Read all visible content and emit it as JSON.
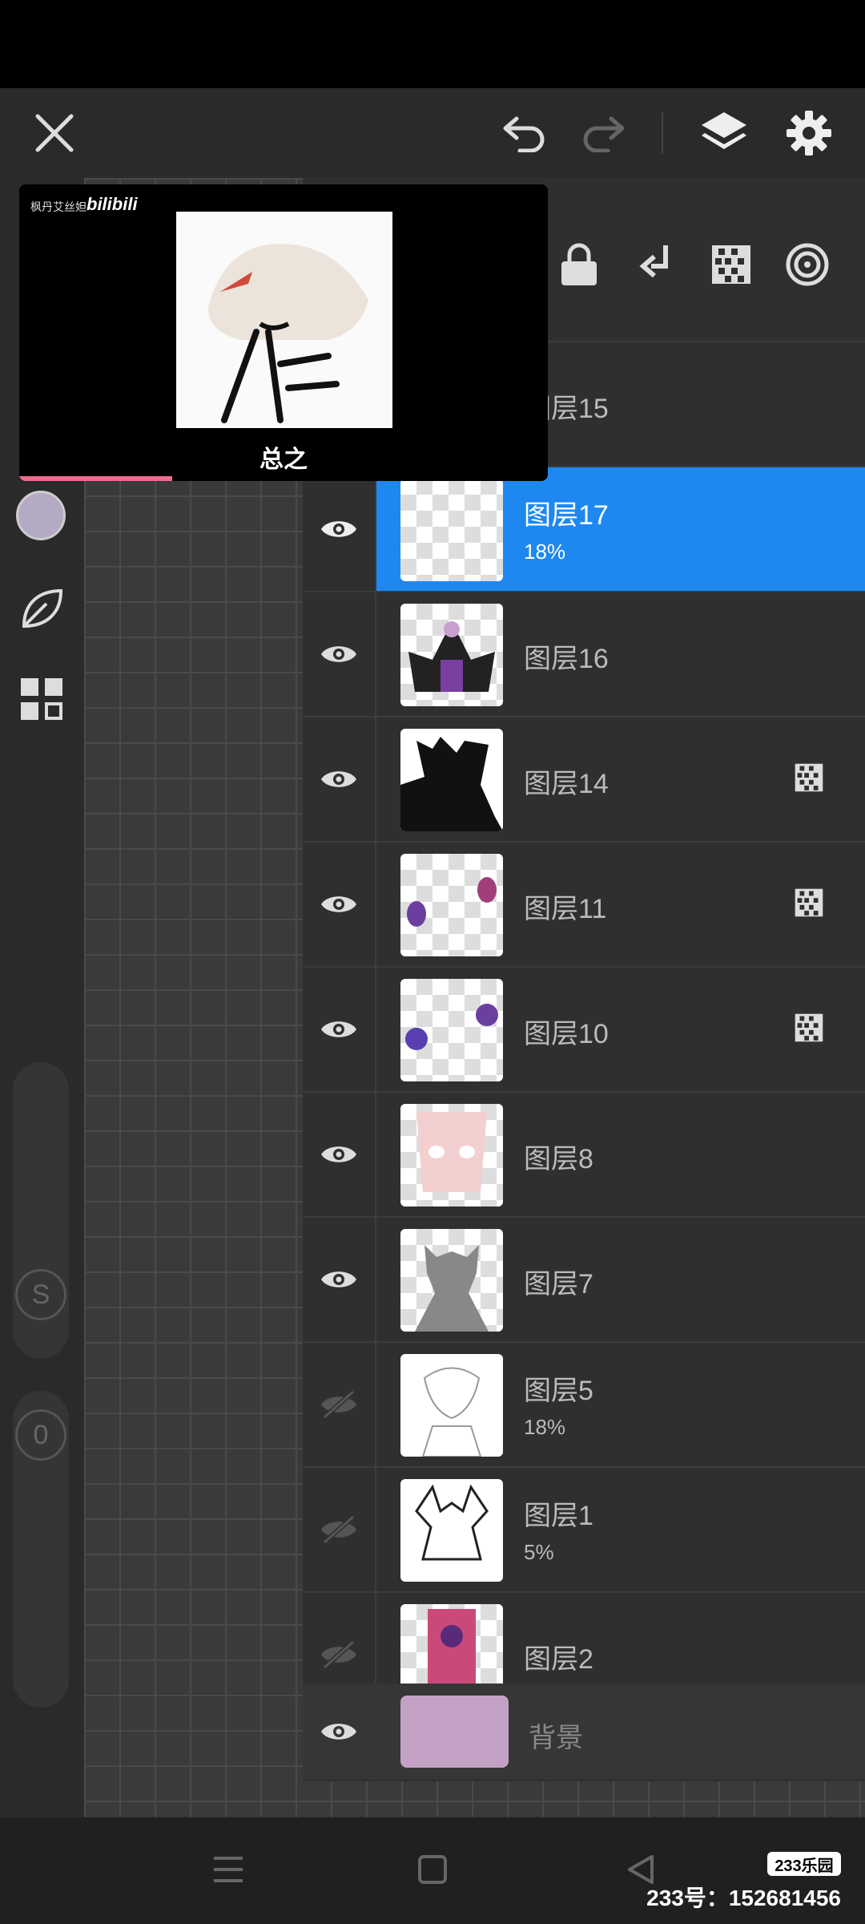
{
  "colors": {
    "accent": "#1e88f0",
    "background_swatch": "#c3a1c5",
    "brush_color": "#b5aac3"
  },
  "layers": [
    {
      "name": "图层15",
      "opacity": "",
      "visible": true,
      "selected": false,
      "mask": false
    },
    {
      "name": "图层17",
      "opacity": "18%",
      "visible": true,
      "selected": true,
      "mask": false
    },
    {
      "name": "图层16",
      "opacity": "",
      "visible": true,
      "selected": false,
      "mask": false
    },
    {
      "name": "图层14",
      "opacity": "",
      "visible": true,
      "selected": false,
      "mask": true
    },
    {
      "name": "图层11",
      "opacity": "",
      "visible": true,
      "selected": false,
      "mask": true
    },
    {
      "name": "图层10",
      "opacity": "",
      "visible": true,
      "selected": false,
      "mask": true
    },
    {
      "name": "图层8",
      "opacity": "",
      "visible": true,
      "selected": false,
      "mask": false
    },
    {
      "name": "图层7",
      "opacity": "",
      "visible": true,
      "selected": false,
      "mask": false
    },
    {
      "name": "图层5",
      "opacity": "18%",
      "visible": false,
      "selected": false,
      "mask": false
    },
    {
      "name": "图层1",
      "opacity": "5%",
      "visible": false,
      "selected": false,
      "mask": false
    },
    {
      "name": "图层2",
      "opacity": "",
      "visible": false,
      "selected": false,
      "mask": false
    }
  ],
  "background_layer": {
    "name": "背景"
  },
  "side_labels": {
    "stabilizer": "S",
    "counter": "0"
  },
  "video": {
    "channel": "枫丹艾丝妲",
    "brand": "bilibili",
    "caption": "总之",
    "progress": 0.29
  },
  "watermark": {
    "badge": "233乐园",
    "text": "233号：152681456"
  },
  "icons": {
    "close": "close-icon",
    "undo": "undo-icon",
    "redo": "redo-icon",
    "layers": "layers-icon",
    "settings": "gear-icon",
    "lock": "lock-icon",
    "merge_down": "merge-down-icon",
    "transparency": "checker-icon",
    "target": "target-icon"
  }
}
